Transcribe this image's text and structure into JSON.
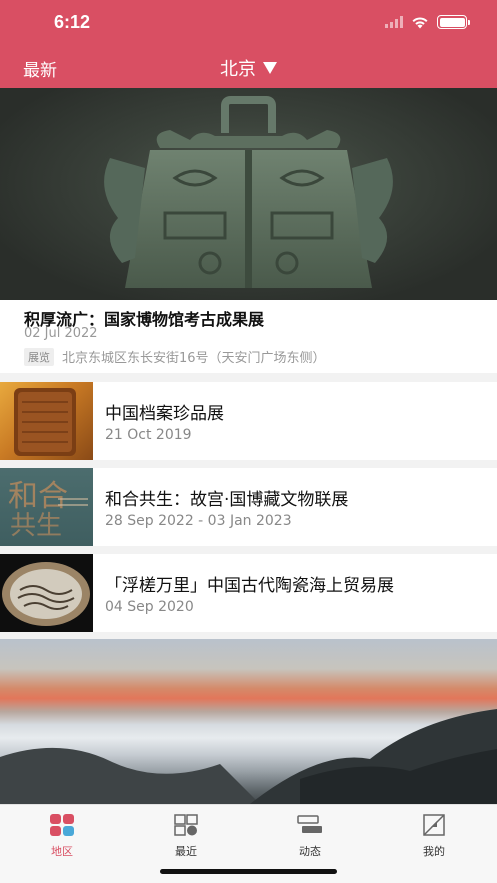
{
  "status_bar": {
    "time": "6:12"
  },
  "header": {
    "left_label": "最新",
    "city": "北京",
    "city_dropdown_icon": "triangle-down-icon"
  },
  "featured": {
    "title": "积厚流广：国家博物馆考古成果展",
    "date": "02 Jul 2022",
    "tag": "展览",
    "location": "北京东城区东长安街16号（天安门广场东侧）"
  },
  "exhibitions": [
    {
      "title": "中国档案珍品展",
      "date": "21 Oct 2019"
    },
    {
      "title": "和合共生：故宫·国博藏文物联展",
      "date": "28 Sep 2022 - 03 Jan 2023"
    },
    {
      "title": "「浮槎万里」中国古代陶瓷海上贸易展",
      "date": "04 Sep 2020"
    }
  ],
  "tabbar": {
    "tabs": [
      {
        "label": "地区",
        "icon": "region-icon",
        "active": true
      },
      {
        "label": "最近",
        "icon": "recent-icon",
        "active": false
      },
      {
        "label": "动态",
        "icon": "feed-icon",
        "active": false
      },
      {
        "label": "我的",
        "icon": "profile-icon",
        "active": false
      }
    ]
  },
  "colors": {
    "accent": "#d94f63",
    "background": "#f2f2f2"
  }
}
